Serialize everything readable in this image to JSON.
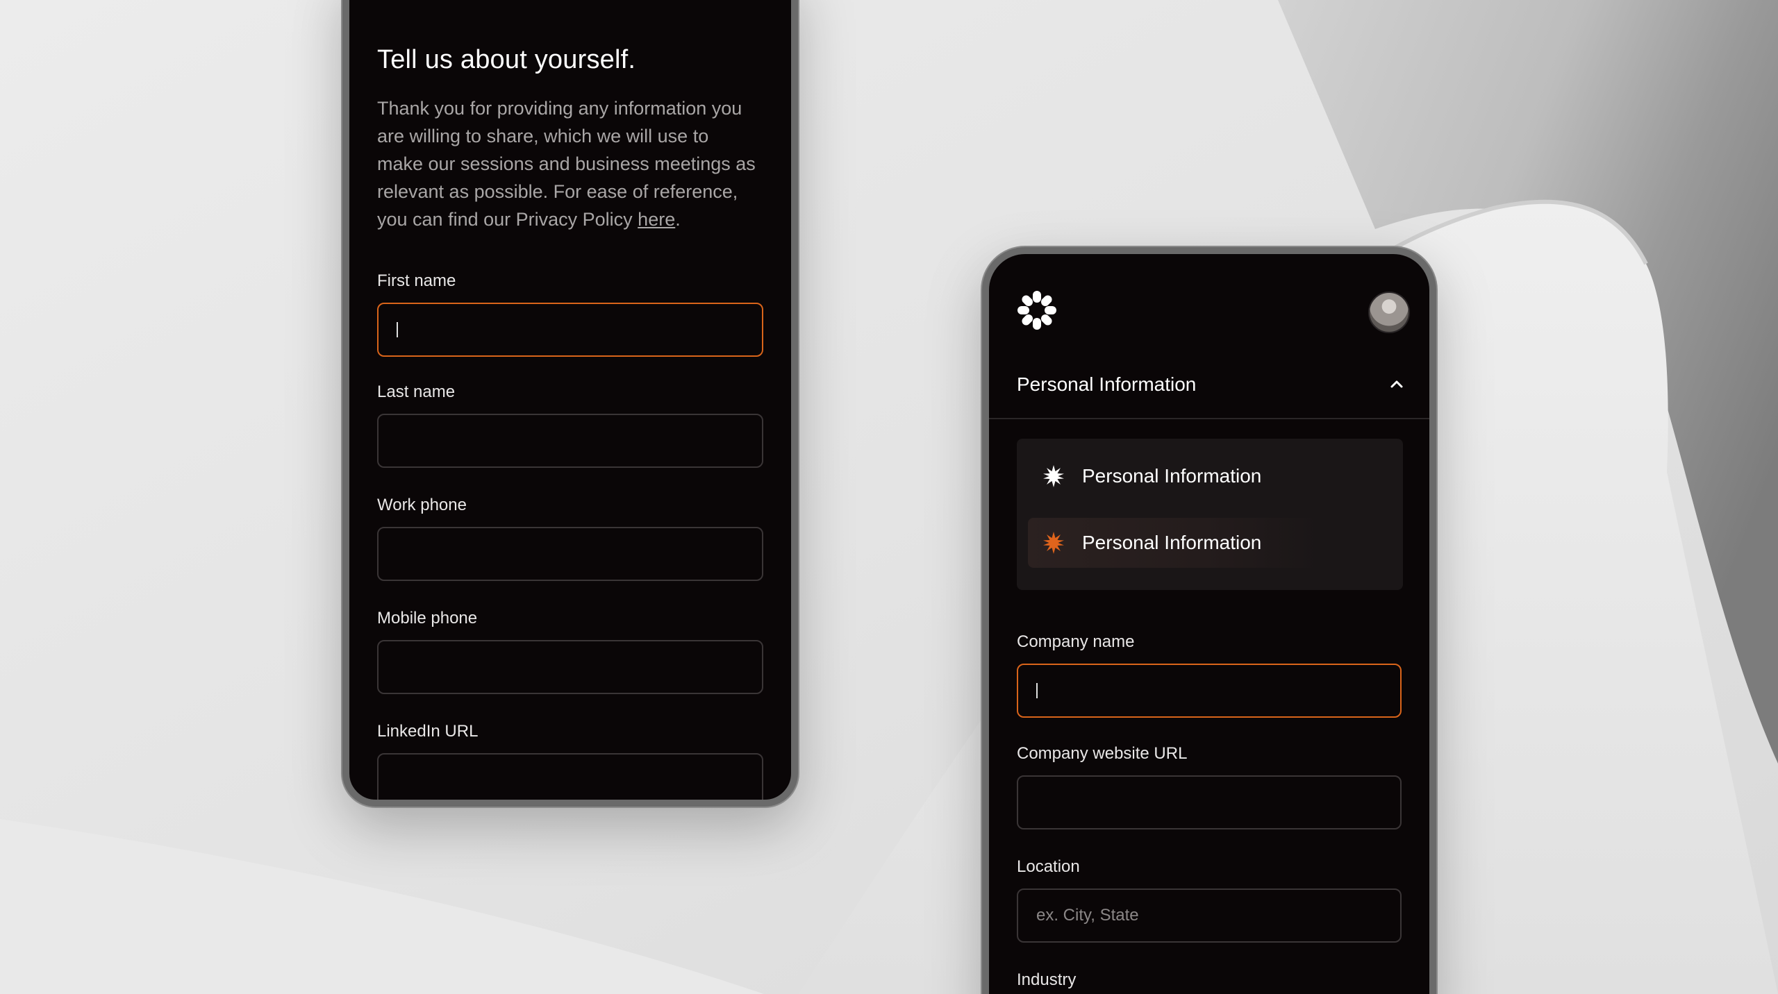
{
  "left_form": {
    "title": "Tell us about yourself.",
    "intro_text": "Thank you for providing any information you are willing to share, which we will use to make our sessions and business meetings as relevant as possible. For ease of reference, you can find our Privacy Policy ",
    "intro_link": "here",
    "intro_end": ".",
    "fields": [
      {
        "label": "First name",
        "value": "",
        "active": true
      },
      {
        "label": "Last name",
        "value": ""
      },
      {
        "label": "Work phone",
        "value": ""
      },
      {
        "label": "Mobile phone",
        "value": ""
      },
      {
        "label": "LinkedIn URL",
        "value": ""
      }
    ]
  },
  "right_form": {
    "logo_icon": "starburst-logo-icon",
    "avatar": "user-avatar",
    "accordion_title": "Personal Information",
    "menu_items": [
      {
        "label": "Personal Information",
        "icon": "starburst-icon",
        "color": "#ffffff"
      },
      {
        "label": "Personal Information",
        "icon": "starburst-icon",
        "color": "#e0641c",
        "selected": true
      }
    ],
    "fields": [
      {
        "label": "Company name",
        "value": "",
        "active": true
      },
      {
        "label": "Company website URL",
        "value": ""
      },
      {
        "label": "Location",
        "placeholder": "ex. City, State"
      },
      {
        "label": "Industry"
      }
    ]
  },
  "colors": {
    "accent": "#d9641a",
    "panel_bg": "#0a0607",
    "menu_bg": "#1a1617"
  }
}
